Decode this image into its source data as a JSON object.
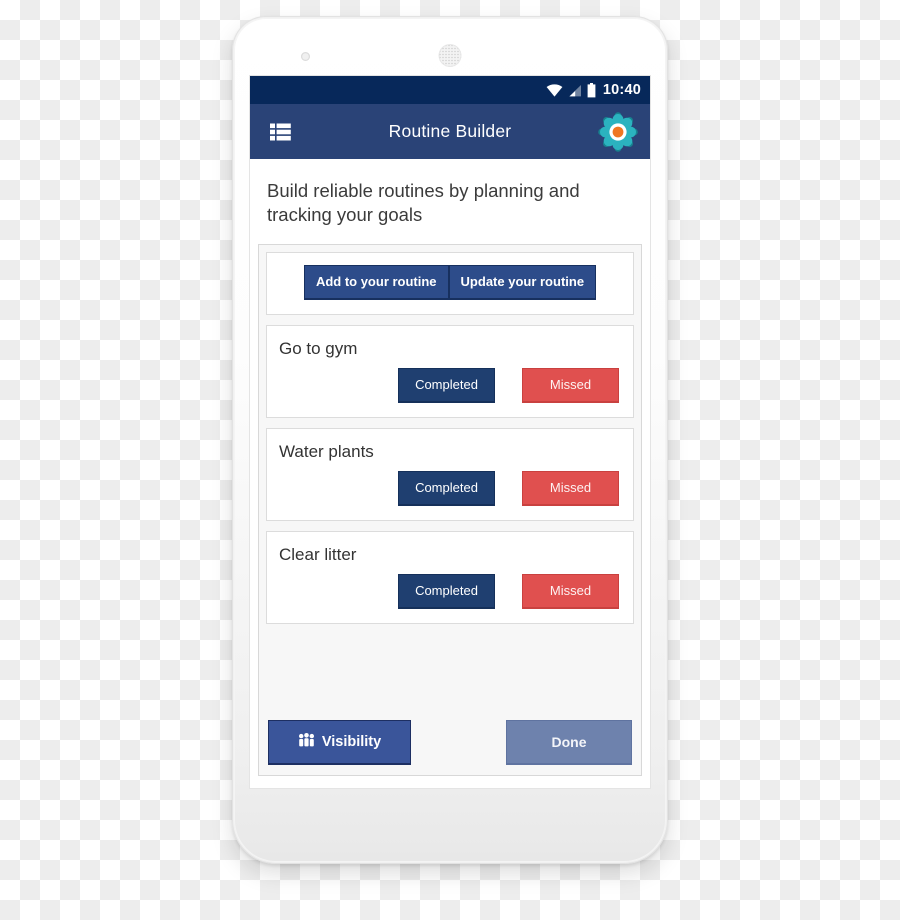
{
  "status_bar": {
    "time": "10:40",
    "icons": [
      "wifi-icon",
      "signal-icon",
      "battery-icon"
    ]
  },
  "app_bar": {
    "title": "Routine Builder",
    "menu_icon": "list-menu-icon",
    "settings_icon": "gear-icon",
    "background_color": "#2a4377",
    "status_bar_color": "#07285a"
  },
  "intro": {
    "text": "Build reliable routines by planning and tracking your goals"
  },
  "actions": {
    "add_label": "Add to your routine",
    "update_label": "Update your routine"
  },
  "routines": [
    {
      "title": "Go to gym",
      "completed_label": "Completed",
      "missed_label": "Missed"
    },
    {
      "title": "Water plants",
      "completed_label": "Completed",
      "missed_label": "Missed"
    },
    {
      "title": "Clear litter",
      "completed_label": "Completed",
      "missed_label": "Missed"
    }
  ],
  "footer": {
    "visibility_label": "Visibility",
    "visibility_icon": "people-group-icon",
    "done_label": "Done"
  },
  "colors": {
    "primary_blue": "#2d4c8a",
    "completed_blue": "#1f3f70",
    "missed_red": "#e0504f",
    "done_slate": "#6e82ad",
    "gear_teal": "#1b9aaa",
    "gear_orange": "#f07d22"
  }
}
